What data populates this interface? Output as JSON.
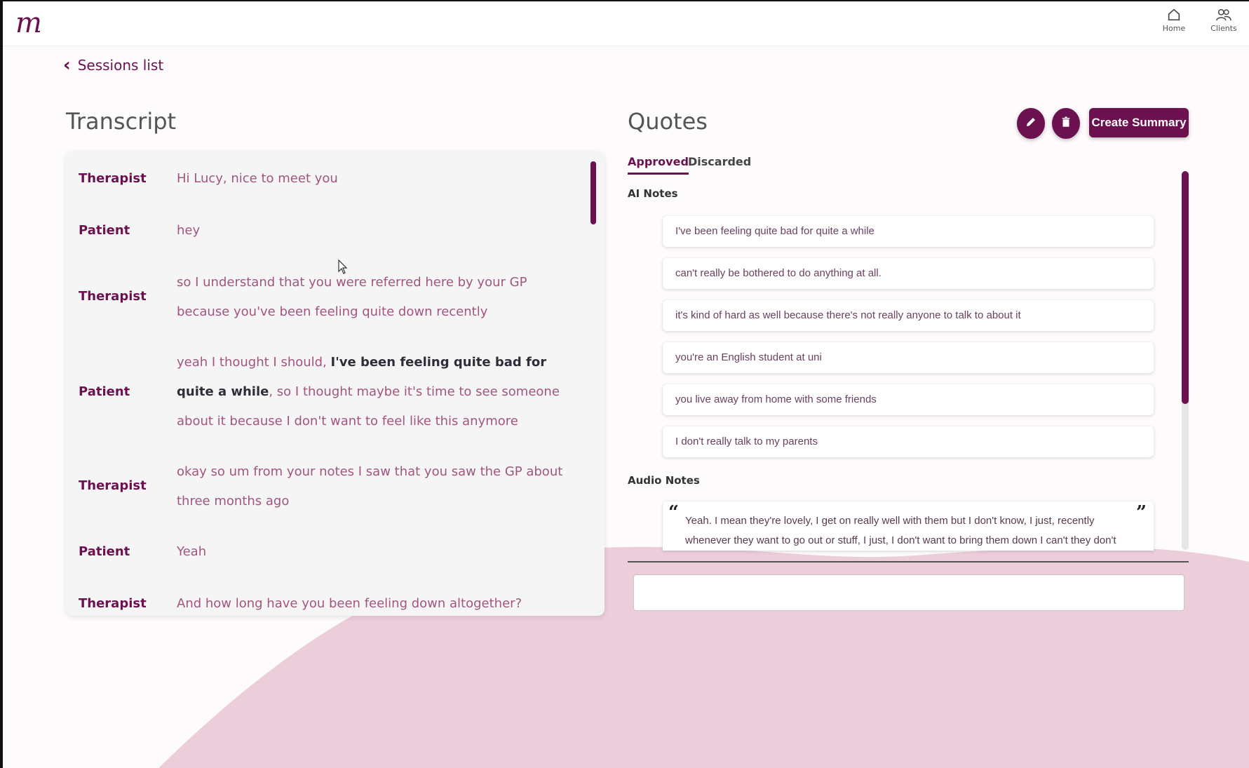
{
  "app": {
    "logo_text": "m"
  },
  "nav": {
    "home_label": "Home",
    "clients_label": "Clients"
  },
  "back": {
    "label": "Sessions list"
  },
  "transcript": {
    "title": "Transcript",
    "rows": [
      {
        "speaker": "Therapist",
        "text": "Hi Lucy, nice to meet you"
      },
      {
        "speaker": "Patient",
        "text": "hey"
      },
      {
        "speaker": "Therapist",
        "text": "so I understand that you were referred here by your GP because you've been feeling quite down recently"
      },
      {
        "speaker": "Patient",
        "text_before": "yeah I thought I should, ",
        "highlight": "I've been feeling quite bad for quite a while",
        "text_after": ", so I thought maybe it's time to see someone about it because I don't want to feel like this anymore"
      },
      {
        "speaker": "Therapist",
        "text": "okay so um from your notes I saw that you saw the GP about three months ago"
      },
      {
        "speaker": "Patient",
        "text": "Yeah"
      },
      {
        "speaker": "Therapist",
        "text": "And how long have you been feeling down altogether?"
      }
    ]
  },
  "quotes": {
    "title": "Quotes",
    "create_summary_label": "Create Summary",
    "tabs": {
      "approved": "Approved",
      "discarded": "Discarded"
    },
    "ai_notes_label": "AI Notes",
    "ai_notes": [
      "I've been feeling quite bad for quite a while",
      "can't really be bothered to do anything at all.",
      "it's kind of hard as well because there's not really anyone to talk to about it",
      "you're an English student at uni",
      "you live away from home with some friends",
      "I don't really talk to my parents"
    ],
    "audio_notes_label": "Audio Notes",
    "audio_note": "Yeah. I mean they're lovely, I get on really well with them but I don't know, I just, recently whenever they want to go out or stuff, I just, I don't want to bring them down I can't they don't",
    "input_value": ""
  },
  "colors": {
    "brand": "#6b1150",
    "wave": "#e9c4d3",
    "speaker": "#6b1150",
    "transcript_text": "#a0567f"
  },
  "icons": {
    "home": "home-icon",
    "clients": "users-icon",
    "back": "chevron-left-icon",
    "edit": "pencil-icon",
    "delete": "trash-icon",
    "quote_open": "quote-open-icon",
    "quote_close": "quote-close-icon"
  }
}
